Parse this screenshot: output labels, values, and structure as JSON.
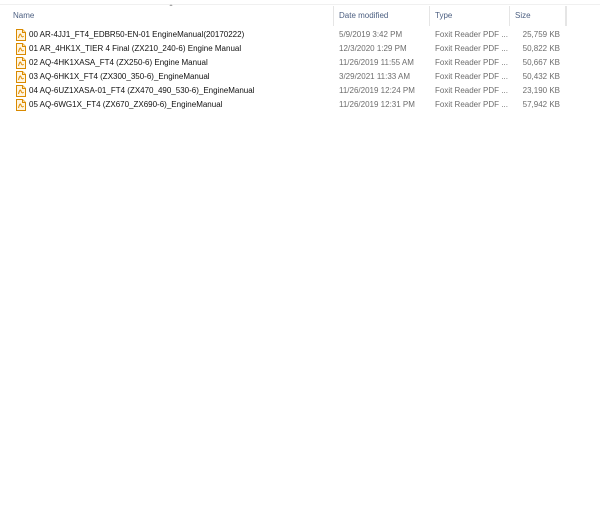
{
  "columns": {
    "name": "Name",
    "date_modified": "Date modified",
    "type": "Type",
    "size": "Size"
  },
  "sort_icon": "chevron-up-icon",
  "file_icon": "pdf-file-icon",
  "files": [
    {
      "name": "00 AR-4JJ1_FT4_EDBR50-EN-01 EngineManual(20170222)",
      "date": "5/9/2019 3:42 PM",
      "type": "Foxit Reader PDF ...",
      "size": "25,759 KB"
    },
    {
      "name": "01 AR_4HK1X_TIER 4 Final (ZX210_240-6) Engine Manual",
      "date": "12/3/2020 1:29 PM",
      "type": "Foxit Reader PDF ...",
      "size": "50,822 KB"
    },
    {
      "name": "02 AQ-4HK1XASA_FT4 (ZX250-6) Engine Manual",
      "date": "11/26/2019 11:55 AM",
      "type": "Foxit Reader PDF ...",
      "size": "50,667 KB"
    },
    {
      "name": "03 AQ-6HK1X_FT4 (ZX300_350-6)_EngineManual",
      "date": "3/29/2021 11:33 AM",
      "type": "Foxit Reader PDF ...",
      "size": "50,432 KB"
    },
    {
      "name": "04 AQ-6UZ1XASA-01_FT4 (ZX470_490_530-6)_EngineManual",
      "date": "11/26/2019 12:24 PM",
      "type": "Foxit Reader PDF ...",
      "size": "23,190 KB"
    },
    {
      "name": "05 AQ-6WG1X_FT4 (ZX670_ZX690-6)_EngineManual",
      "date": "11/26/2019 12:31 PM",
      "type": "Foxit Reader PDF ...",
      "size": "57,942 KB"
    }
  ]
}
